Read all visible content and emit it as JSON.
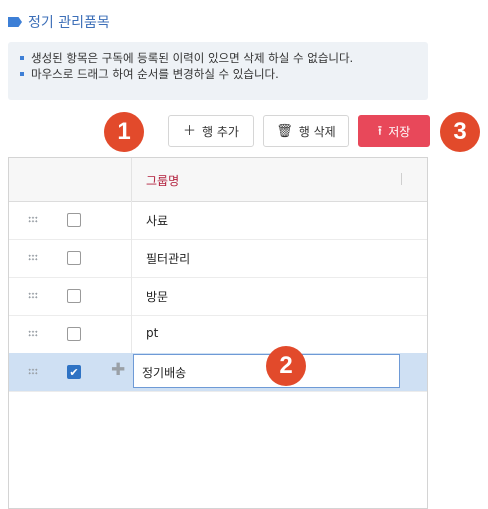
{
  "header": {
    "title": "정기 관리품목",
    "icon": "tag-icon"
  },
  "notice": {
    "lines": [
      "생성된 항목은 구독에 등록된 이력이 있으면 삭제 하실 수 없습니다.",
      "마우스로 드래그 하여 순서를 변경하실 수 있습니다."
    ]
  },
  "toolbar": {
    "add_label": "행 추가",
    "delete_label": "행 삭제",
    "save_label": "저장",
    "save_color": "#e8485a"
  },
  "badges": [
    "1",
    "2",
    "3"
  ],
  "grid": {
    "column_header": "그룹명",
    "rows": [
      {
        "name": "사료",
        "checked": false,
        "selected": false
      },
      {
        "name": "필터관리",
        "checked": false,
        "selected": false
      },
      {
        "name": "방문",
        "checked": false,
        "selected": false
      },
      {
        "name": "pt",
        "checked": false,
        "selected": false
      },
      {
        "name": "정기배송",
        "checked": true,
        "selected": true,
        "editing": true
      }
    ]
  }
}
